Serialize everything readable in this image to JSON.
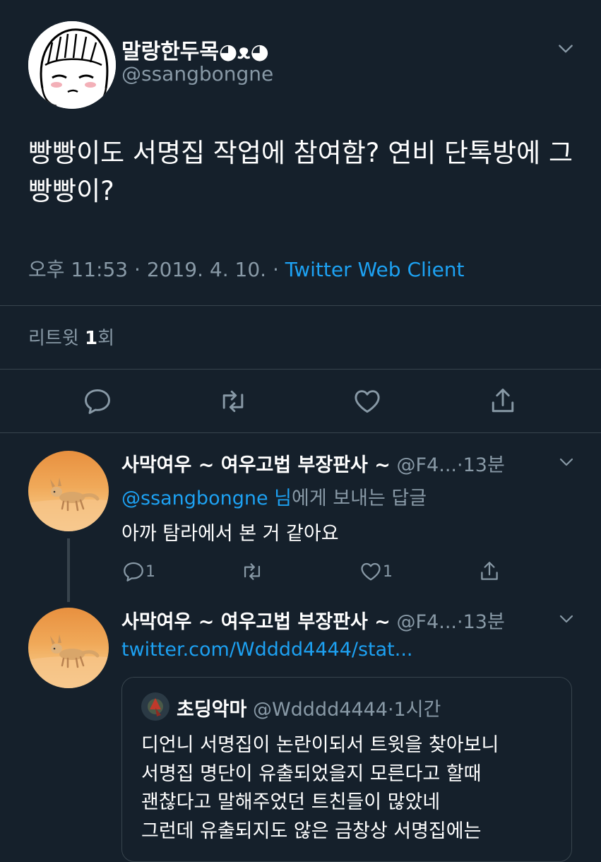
{
  "main_tweet": {
    "display_name": "말랑한두목◕ᴥ◕",
    "handle": "@ssangbongne",
    "text": "빵빵이도 서명집 작업에 참여함? 연비 단톡방에 그 빵빵이?",
    "time": "오후 11:53",
    "date": "2019. 4. 10.",
    "separator": "·",
    "source": "Twitter Web Client",
    "retweet_label": "리트윗",
    "retweet_count": "1",
    "retweet_suffix": "회"
  },
  "replies": [
    {
      "display_name": "사막여우 ~ 여우고법 부장판사 ~",
      "handle": "@F4...",
      "time": "·13분",
      "mention": "@ssangbongne 님",
      "reply_to_suffix": "에게 보내는 답글",
      "text": "아까 탐라에서 본 거 같아요",
      "reply_count": "1",
      "like_count": "1"
    },
    {
      "display_name": "사막여우 ~ 여우고법 부장판사 ~",
      "handle": "@F4...",
      "time": "·13분",
      "link": "twitter.com/Wdddd4444/stat..."
    }
  ],
  "quoted_tweet": {
    "display_name": "초딩악마",
    "handle": "@Wdddd4444",
    "time": "·1시간",
    "lines": [
      "디언니 서명집이 논란이되서 트윗을 찾아보니",
      "서명집 명단이 유출되었을지 모른다고 할때",
      "괜찮다고 말해주었던 트친들이 많았네",
      "그런데 유출되지도 않은 금창상 서명집에는"
    ]
  },
  "colors": {
    "background": "#15202b",
    "muted": "#8899a6",
    "link": "#1da1f2",
    "divider": "#38444d"
  }
}
